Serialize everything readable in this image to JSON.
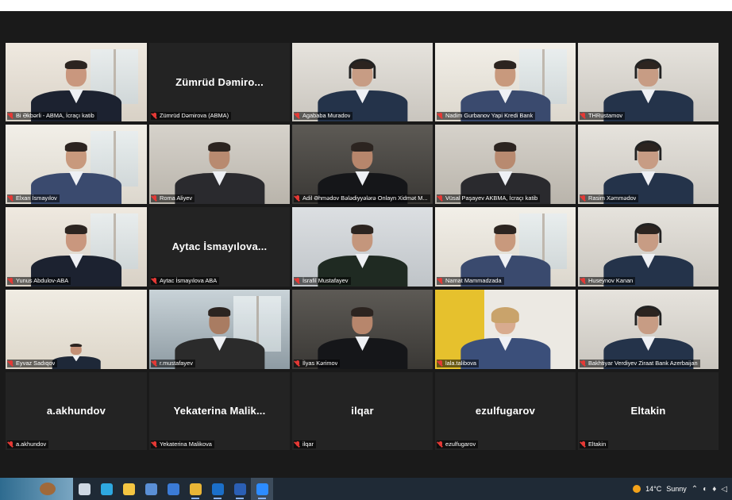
{
  "participants": [
    {
      "label": "Bi Əkbərli - ABMA, İcraçı katib",
      "mode": "video",
      "tone": "office"
    },
    {
      "label": "Zümrüd Dəmirova (ABMA)",
      "mode": "name",
      "display_name": "Zümrüd Dəmiro..."
    },
    {
      "label": "Agababa Muradov",
      "mode": "video",
      "tone": "headset"
    },
    {
      "label": "Nadim Gurbanov Yapi Kredi Bank",
      "mode": "video",
      "tone": "bright"
    },
    {
      "label": "THRustamov",
      "mode": "video",
      "tone": "headset"
    },
    {
      "label": "Elxan İsmayılov",
      "mode": "video",
      "tone": "bright"
    },
    {
      "label": "Roma Aliyev",
      "mode": "video",
      "tone": "plain"
    },
    {
      "label": "Adil Əhmədov Bələdiyyələrə Onlayn Xidmət M...",
      "mode": "video",
      "tone": "dark"
    },
    {
      "label": "Vüsal Paşayev AKBMA, İcraçı katib",
      "mode": "video",
      "tone": "plain"
    },
    {
      "label": "Rasim Xəmmədov",
      "mode": "video",
      "tone": "headset"
    },
    {
      "label": "Yunus Abdulov-ABA",
      "mode": "video",
      "tone": "office",
      "active": true
    },
    {
      "label": "Aytac İsmayılova ABA",
      "mode": "name",
      "display_name": "Aytac İsmayılova..."
    },
    {
      "label": "İsrafil Mustafayev",
      "mode": "video",
      "tone": "uniform"
    },
    {
      "label": "Namat Mammadzada",
      "mode": "video",
      "tone": "bright"
    },
    {
      "label": "Huseynov Kanan",
      "mode": "video",
      "tone": "headset"
    },
    {
      "label": "Eyvaz Sadıqov",
      "mode": "video",
      "tone": "small"
    },
    {
      "label": "r.mustafayev",
      "mode": "video",
      "tone": "window"
    },
    {
      "label": "İlyas Kərimov",
      "mode": "video",
      "tone": "dark"
    },
    {
      "label": "lala.talibova",
      "mode": "video",
      "tone": "yellow"
    },
    {
      "label": "Bakhtiyar Verdiyev Ziraat Bank Azerbaijan",
      "mode": "video",
      "tone": "headset"
    },
    {
      "label": "a.akhundov",
      "mode": "name",
      "display_name": "a.akhundov"
    },
    {
      "label": "Yekaterina Malikova",
      "mode": "name",
      "display_name": "Yekaterina Malik..."
    },
    {
      "label": "ilqar",
      "mode": "name",
      "display_name": "ilqar"
    },
    {
      "label": "ezulfugarov",
      "mode": "name",
      "display_name": "ezulfugarov"
    },
    {
      "label": "Eltakin",
      "mode": "name",
      "display_name": "Eltakin"
    }
  ],
  "taskbar": {
    "weather_temp": "14°C",
    "weather_text": "Sunny",
    "apps": [
      {
        "name": "task-view-icon",
        "color": "#cfd8e3",
        "running": false
      },
      {
        "name": "edge-icon",
        "color": "#2ea8e0",
        "running": false
      },
      {
        "name": "file-explorer-icon",
        "color": "#f4c542",
        "running": false
      },
      {
        "name": "store-icon",
        "color": "#5a8fd6",
        "running": false
      },
      {
        "name": "mail-icon",
        "color": "#3b7bd6",
        "running": false
      },
      {
        "name": "chrome-icon",
        "color": "#e9b536",
        "running": true
      },
      {
        "name": "outlook-icon",
        "color": "#1b6fc9",
        "running": true
      },
      {
        "name": "word-icon",
        "color": "#2b5fb4",
        "running": true
      },
      {
        "name": "zoom-icon",
        "color": "#2d8cff",
        "running": true,
        "selected": true
      }
    ]
  }
}
